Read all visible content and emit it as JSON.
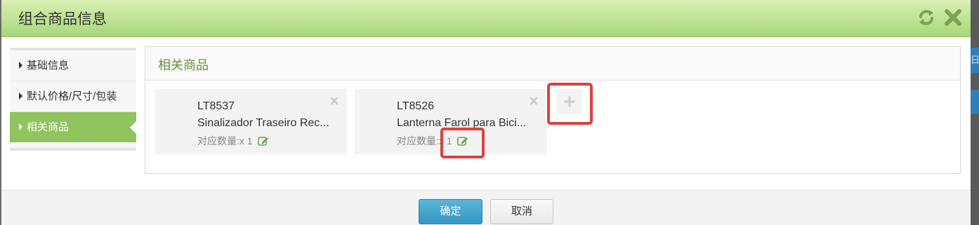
{
  "dialog": {
    "title": "组合商品信息"
  },
  "backdrop": {
    "edge_text": "日"
  },
  "sidebar": {
    "items": [
      {
        "label": "基础信息",
        "active": false
      },
      {
        "label": "默认价格/尺寸/包装",
        "active": false
      },
      {
        "label": "相关商品",
        "active": true
      }
    ]
  },
  "panel": {
    "title": "相关商品",
    "products": [
      {
        "code": "LT8537",
        "name": "Sinalizador Traseiro Rec...",
        "qty_label": "对应数量:x 1"
      },
      {
        "code": "LT8526",
        "name": "Lanterna Farol para Bici...",
        "qty_label": "对应数量:x 1"
      }
    ],
    "add_symbol": "+"
  },
  "footer": {
    "ok_label": "确定",
    "cancel_label": "取消"
  },
  "colors": {
    "header_green": "#a8d77a",
    "active_green": "#8fc45e",
    "accent_text_green": "#6a8f36",
    "highlight_red": "#e0403c",
    "primary_blue": "#3596c3"
  }
}
